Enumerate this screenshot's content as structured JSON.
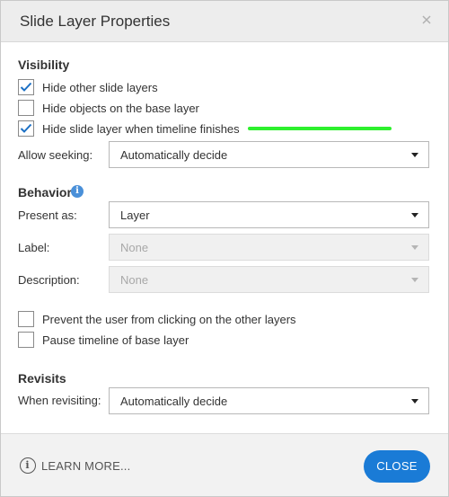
{
  "dialog": {
    "title": "Slide Layer Properties",
    "close_icon": "close-x-icon"
  },
  "visibility": {
    "heading": "Visibility",
    "options": [
      {
        "label": "Hide other slide layers",
        "checked": true
      },
      {
        "label": "Hide objects on the base layer",
        "checked": false
      },
      {
        "label": "Hide slide layer when timeline finishes",
        "checked": true
      }
    ],
    "allow_seeking_label": "Allow seeking:",
    "allow_seeking_value": "Automatically decide"
  },
  "behavior": {
    "heading": "Behavior",
    "info_icon": "info-icon",
    "present_as_label": "Present as:",
    "present_as_value": "Layer",
    "label_label": "Label:",
    "label_value": "None",
    "description_label": "Description:",
    "description_value": "None",
    "options": [
      {
        "label": "Prevent the user from clicking on the other layers",
        "checked": false
      },
      {
        "label": "Pause timeline of base layer",
        "checked": false
      }
    ]
  },
  "revisits": {
    "heading": "Revisits",
    "when_revisiting_label": "When revisiting:",
    "when_revisiting_value": "Automatically decide"
  },
  "footer": {
    "learn_more": "LEARN MORE...",
    "close_button": "CLOSE"
  },
  "colors": {
    "accent": "#1a7bd6",
    "highlight": "#2ef02e",
    "checkmark": "#1a6fc4"
  }
}
